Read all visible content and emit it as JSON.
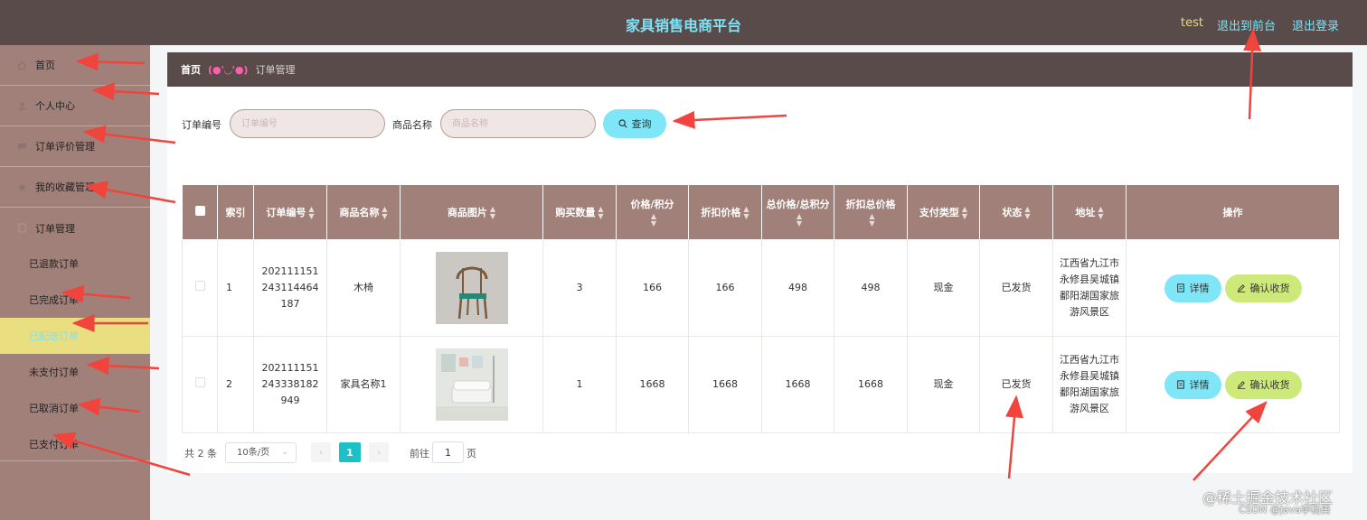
{
  "header": {
    "title": "家具销售电商平台",
    "user": "test",
    "to_front": "退出到前台",
    "logout": "退出登录"
  },
  "sidebar": {
    "items": [
      {
        "label": "首页",
        "icon": "home-icon"
      },
      {
        "label": "个人中心",
        "icon": "user-icon"
      },
      {
        "label": "订单评价管理",
        "icon": "comment-icon"
      },
      {
        "label": "我的收藏管理",
        "icon": "star-icon"
      },
      {
        "label": "订单管理",
        "icon": "order-icon"
      }
    ],
    "subitems": [
      {
        "label": "已退款订单"
      },
      {
        "label": "已完成订单"
      },
      {
        "label": "已配送订单"
      },
      {
        "label": "未支付订单"
      },
      {
        "label": "已取消订单"
      },
      {
        "label": "已支付订单"
      }
    ]
  },
  "breadcrumb": {
    "home": "首页",
    "separator": "(●'◡'●)",
    "current": "订单管理"
  },
  "search": {
    "order_no_label": "订单编号",
    "order_no_placeholder": "订单编号",
    "product_label": "商品名称",
    "product_placeholder": "商品名称",
    "button": "查询"
  },
  "table": {
    "headers": {
      "index": "索引",
      "order_no": "订单编号",
      "product_name": "商品名称",
      "product_image": "商品图片",
      "quantity": "购买数量",
      "price": "价格/积分",
      "discount_price": "折扣价格",
      "total": "总价格/总积分",
      "discount_total": "折扣总价格",
      "pay_type": "支付类型",
      "status": "状态",
      "address": "地址",
      "actions": "操作"
    },
    "rows": [
      {
        "index": "1",
        "order_no": "202111151243114464187",
        "product_name": "木椅",
        "quantity": "3",
        "price": "166",
        "discount_price": "166",
        "total": "498",
        "discount_total": "498",
        "pay_type": "现金",
        "status": "已发货",
        "address": "江西省九江市永修县吴城镇鄱阳湖国家旅游风景区",
        "detail": "详情",
        "confirm": "确认收货"
      },
      {
        "index": "2",
        "order_no": "202111151243338182949",
        "product_name": "家具名称1",
        "quantity": "1",
        "price": "1668",
        "discount_price": "1668",
        "total": "1668",
        "discount_total": "1668",
        "pay_type": "现金",
        "status": "已发货",
        "address": "江西省九江市永修县吴城镇鄱阳湖国家旅游风景区",
        "detail": "详情",
        "confirm": "确认收货"
      }
    ]
  },
  "pagination": {
    "total": "共 2 条",
    "page_size": "10条/页",
    "current_page": "1",
    "goto_label": "前往",
    "goto_value": "1",
    "goto_unit": "页"
  },
  "watermark": {
    "line1": "@稀土掘金技术社区",
    "line2": "CSDN @java李杨勇"
  },
  "colors": {
    "header_bg": "#5a4b4b",
    "sidebar_bg": "#a1807a",
    "accent_cyan": "#7fe6f7",
    "accent_green": "#cde97a",
    "active_menu": "#e9de80",
    "annotation_red": "#f0443c"
  }
}
